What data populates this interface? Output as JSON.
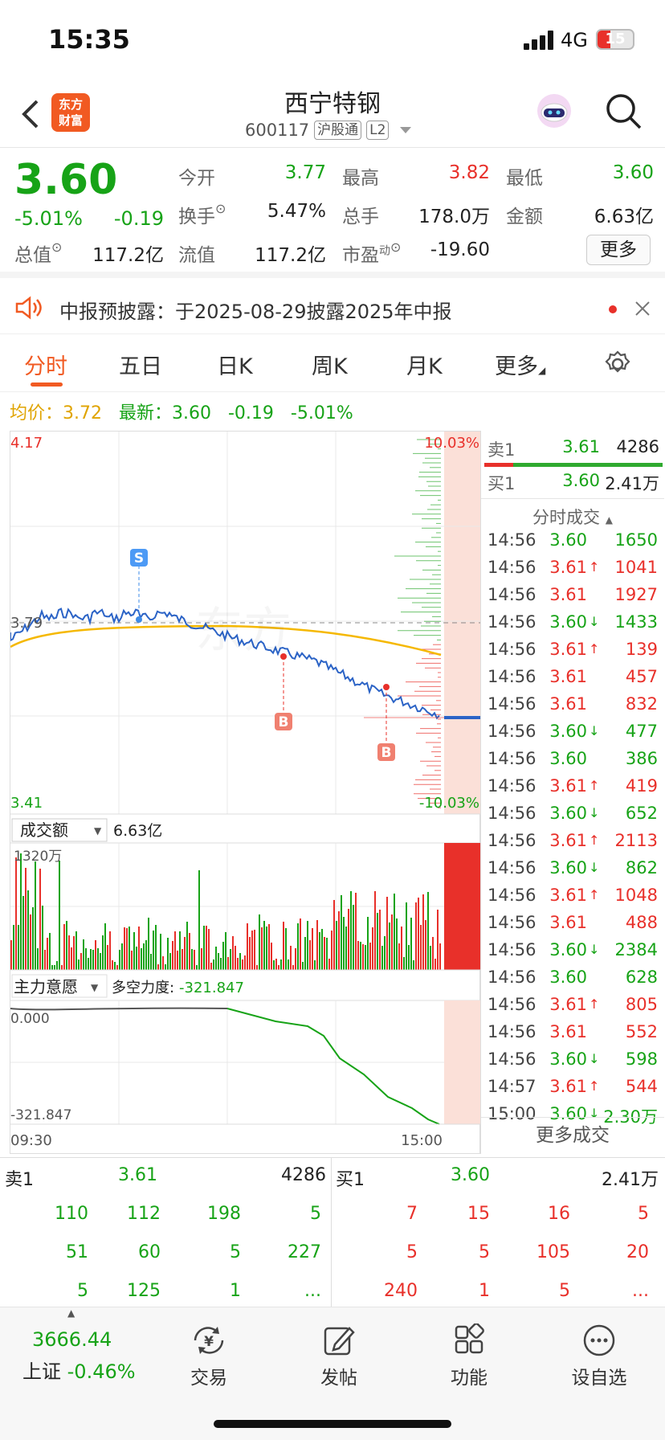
{
  "status_bar": {
    "time": "15:35",
    "network": "4G",
    "battery": "15"
  },
  "header": {
    "back_icon": "chevron-left-icon",
    "logo": [
      "东方",
      "财富"
    ],
    "stock_name": "西宁特钢",
    "stock_code": "600117",
    "tag1": "沪股通",
    "tag2": "L2",
    "robot_icon": "robot-icon",
    "search_icon": "search-icon"
  },
  "quote": {
    "price": "3.60",
    "change_pct": "-5.01%",
    "change": "-0.19",
    "fields": [
      {
        "label": "今开",
        "value": "3.77",
        "color": "green"
      },
      {
        "label": "最高",
        "value": "3.82",
        "color": "red"
      },
      {
        "label": "最低",
        "value": "3.60",
        "color": "green"
      },
      {
        "label": "换手",
        "value": "5.47%",
        "color": "dark"
      },
      {
        "label": "总手",
        "value": "178.0万",
        "color": "dark"
      },
      {
        "label": "金额",
        "value": "6.63亿",
        "color": "dark"
      },
      {
        "label": "总值",
        "value": "117.2亿",
        "color": "dark"
      },
      {
        "label": "流值",
        "value": "117.2亿",
        "color": "dark"
      },
      {
        "label": "市盈",
        "label_sup": "动",
        "value": "-19.60",
        "color": "dark"
      }
    ],
    "more": "更多"
  },
  "notice": {
    "text": "中报预披露：于2025-08-29披露2025年中报"
  },
  "tabs": [
    "分时",
    "五日",
    "日K",
    "周K",
    "月K",
    "更多"
  ],
  "avg_line": {
    "avg_label": "均价：",
    "avg": "3.72",
    "latest_label": "最新：",
    "latest": "3.60",
    "chg": "-0.19",
    "pct": "-5.01%"
  },
  "chart": {
    "y_top": "4.17",
    "y_mid": "3.79",
    "y_bot": "3.41",
    "pct_top": "10.03%",
    "pct_bot": "-10.03%",
    "s_marker": "S",
    "b_marker": "B",
    "volume_label": "成交额",
    "volume_value": "6.63亿",
    "vol_scale": "1320万",
    "flow_label": "主力意愿",
    "flow_strength_label": "多空力度:",
    "flow_strength": "-321.847",
    "flow_top": "0.000",
    "flow_bot": "-321.847",
    "time_start": "09:30",
    "time_end": "15:00"
  },
  "book": {
    "ask_label": "卖1",
    "ask_price": "3.61",
    "ask_vol": "4286",
    "bid_label": "买1",
    "bid_price": "3.60",
    "bid_vol": "2.41万",
    "trades_title": "分时成交",
    "more_trades": "更多成交",
    "trades": [
      [
        "14:56",
        "3.60",
        "",
        "1650"
      ],
      [
        "14:56",
        "3.61",
        "↑",
        "1041"
      ],
      [
        "14:56",
        "3.61",
        "",
        "1927"
      ],
      [
        "14:56",
        "3.60",
        "↓",
        "1433"
      ],
      [
        "14:56",
        "3.61",
        "↑",
        "139"
      ],
      [
        "14:56",
        "3.61",
        "",
        "457"
      ],
      [
        "14:56",
        "3.61",
        "",
        "832"
      ],
      [
        "14:56",
        "3.60",
        "↓",
        "477"
      ],
      [
        "14:56",
        "3.60",
        "",
        "386"
      ],
      [
        "14:56",
        "3.61",
        "↑",
        "419"
      ],
      [
        "14:56",
        "3.60",
        "↓",
        "652"
      ],
      [
        "14:56",
        "3.61",
        "↑",
        "2113"
      ],
      [
        "14:56",
        "3.60",
        "↓",
        "862"
      ],
      [
        "14:56",
        "3.61",
        "↑",
        "1048"
      ],
      [
        "14:56",
        "3.61",
        "",
        "488"
      ],
      [
        "14:56",
        "3.60",
        "↓",
        "2384"
      ],
      [
        "14:56",
        "3.60",
        "",
        "628"
      ],
      [
        "14:56",
        "3.61",
        "↑",
        "805"
      ],
      [
        "14:56",
        "3.61",
        "",
        "552"
      ],
      [
        "14:56",
        "3.60",
        "↓",
        "598"
      ],
      [
        "14:57",
        "3.61",
        "↑",
        "544"
      ],
      [
        "15:00",
        "3.60",
        "↓",
        "2.30万"
      ]
    ]
  },
  "bottom_book": {
    "sell_label": "卖1",
    "sell_price": "3.61",
    "sell_vol": "4286",
    "buy_label": "买1",
    "buy_price": "3.60",
    "buy_vol": "2.41万",
    "sell_rows": [
      [
        "110",
        "112",
        "198",
        "5"
      ],
      [
        "51",
        "60",
        "5",
        "227"
      ],
      [
        "5",
        "125",
        "1",
        "..."
      ]
    ],
    "buy_rows": [
      [
        "7",
        "15",
        "16",
        "5"
      ],
      [
        "5",
        "5",
        "105",
        "20"
      ],
      [
        "240",
        "1",
        "5",
        "..."
      ]
    ]
  },
  "tabbar": {
    "index_value": "3666.44",
    "index_name": "上证",
    "index_pct": "-0.46%",
    "items": [
      "交易",
      "发帖",
      "功能",
      "设自选"
    ]
  }
}
